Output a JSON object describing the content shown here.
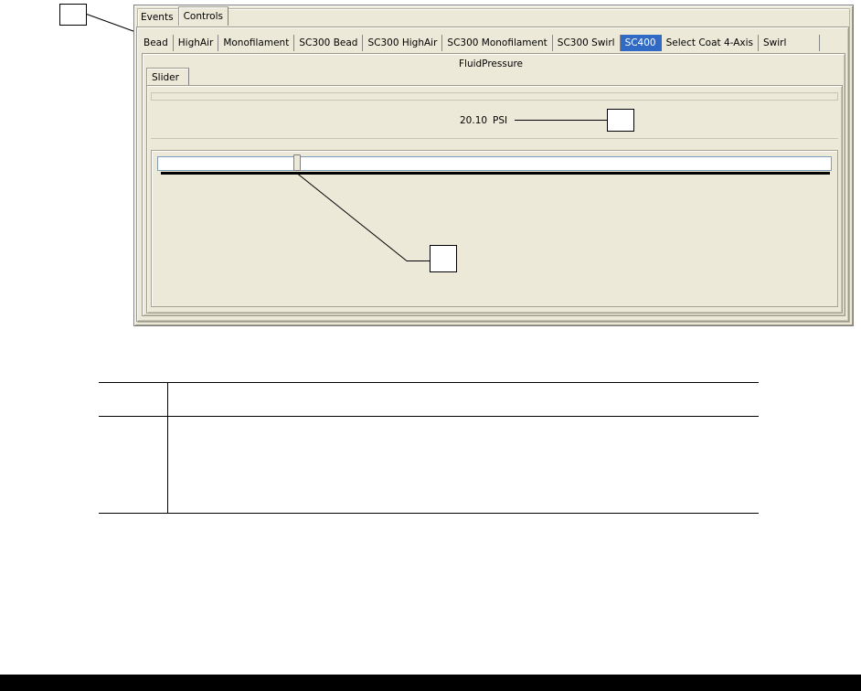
{
  "outer_tabs": [
    {
      "label": "Events",
      "selected": false
    },
    {
      "label": "Controls",
      "selected": true
    }
  ],
  "inner_tabs": [
    {
      "label": "Bead",
      "selected": false
    },
    {
      "label": "HighAir",
      "selected": false
    },
    {
      "label": "Monofilament",
      "selected": false
    },
    {
      "label": "SC300 Bead",
      "selected": false
    },
    {
      "label": "SC300 HighAir",
      "selected": false
    },
    {
      "label": "SC300 Monofilament",
      "selected": false
    },
    {
      "label": "SC300 Swirl",
      "selected": false
    },
    {
      "label": "SC400",
      "selected": true
    },
    {
      "label": "Select Coat 4-Axis",
      "selected": false
    },
    {
      "label": "Swirl",
      "selected": false
    }
  ],
  "control_title": "FluidPressure",
  "sub_tabs": [
    {
      "label": "Slider",
      "selected": true
    }
  ],
  "readout": {
    "value": "20.10",
    "unit": "PSI"
  },
  "slider": {
    "position_fraction": 0.204
  },
  "colors": {
    "selected_tab": "#316ac5",
    "window_bg": "#ece9d8"
  }
}
